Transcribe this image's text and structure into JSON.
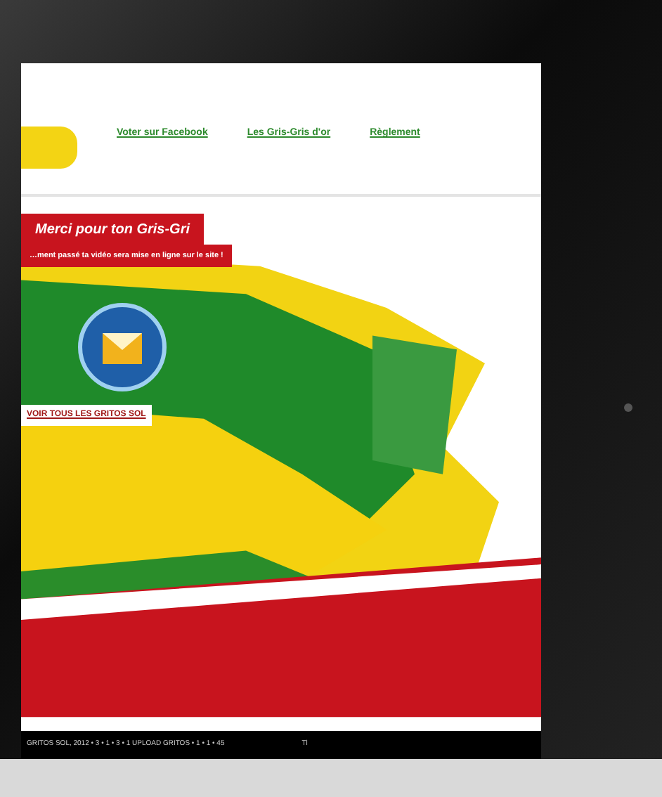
{
  "nav": [
    {
      "label": "Voter sur Facebook"
    },
    {
      "label": "Les Gris-Gris d'or"
    },
    {
      "label": "Règlement"
    }
  ],
  "banner": {
    "title": "Merci pour ton Gris-Gri",
    "subtitle": "…ment passé ta vidéo sera mise en ligne sur le site !"
  },
  "gallery_link": {
    "label": "VOIR TOUS LES GRITOS SOL"
  },
  "footer": {
    "text": "GRITOS SOL, 2012 • 3 • 1 • 3 • 1 UPLOAD GRITOS • 1 • 1 • 45",
    "mark": "Tl"
  }
}
